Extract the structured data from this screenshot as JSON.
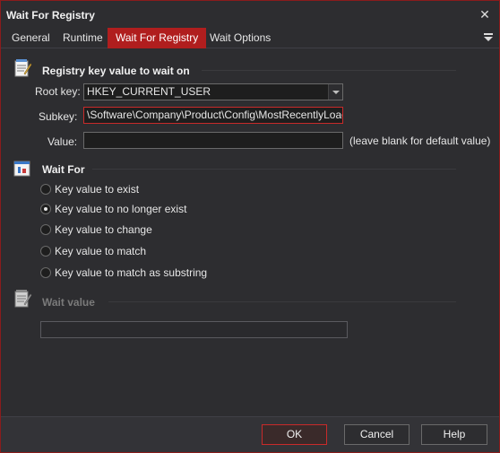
{
  "window": {
    "title": "Wait For Registry"
  },
  "tabs": [
    {
      "label": "General"
    },
    {
      "label": "Runtime"
    },
    {
      "label": "Wait For Registry"
    },
    {
      "label": "Wait Options"
    }
  ],
  "section_registry": {
    "title": "Registry key value to wait on",
    "root_key_label": "Root key:",
    "root_key_value": "HKEY_CURRENT_USER",
    "subkey_label": "Subkey:",
    "subkey_value": "\\Software\\Company\\Product\\Config\\MostRecentlyLoaded",
    "value_label": "Value:",
    "value_value": "",
    "value_hint": "(leave blank for default value)"
  },
  "section_wait_for": {
    "title": "Wait For",
    "options": [
      {
        "label": "Key value to exist",
        "checked": false
      },
      {
        "label": "Key value to no longer exist",
        "checked": true
      },
      {
        "label": "Key value to change",
        "checked": false
      },
      {
        "label": "Key value to match",
        "checked": false
      },
      {
        "label": "Key value to match as substring",
        "checked": false
      }
    ]
  },
  "section_wait_value": {
    "title": "Wait value",
    "value": ""
  },
  "footer": {
    "ok": "OK",
    "cancel": "Cancel",
    "help": "Help"
  },
  "colors": {
    "accent": "#b01e1e",
    "background": "#2d2d30",
    "focus_border": "#c82a2a"
  }
}
